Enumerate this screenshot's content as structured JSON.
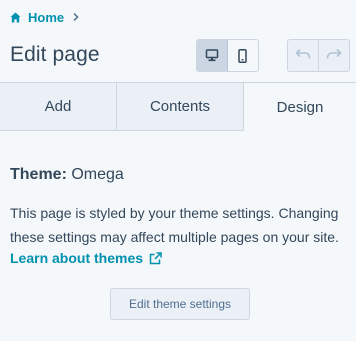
{
  "breadcrumb": {
    "home_label": "Home"
  },
  "header": {
    "title": "Edit page"
  },
  "tabs": [
    {
      "label": "Add"
    },
    {
      "label": "Contents"
    },
    {
      "label": "Design",
      "selected": true
    }
  ],
  "design": {
    "theme_label": "Theme:",
    "theme_name": "Omega",
    "description": "This page is styled by your theme settings. Changing these settings may affect multiple pages on your site.",
    "learn_link": "Learn about themes",
    "edit_button": "Edit theme settings"
  },
  "colors": {
    "link": "#0091ae",
    "text": "#33475b",
    "panel_bg": "#f5f8fa",
    "tab_bg": "#eaf0f6",
    "border": "#cbd6e2"
  },
  "icons": {
    "home": "home-icon",
    "breadcrumb_separator": "chevron-right-icon",
    "desktop": "desktop-icon",
    "mobile": "mobile-icon",
    "undo": "undo-icon",
    "redo": "redo-icon",
    "external_link": "external-link-icon"
  }
}
